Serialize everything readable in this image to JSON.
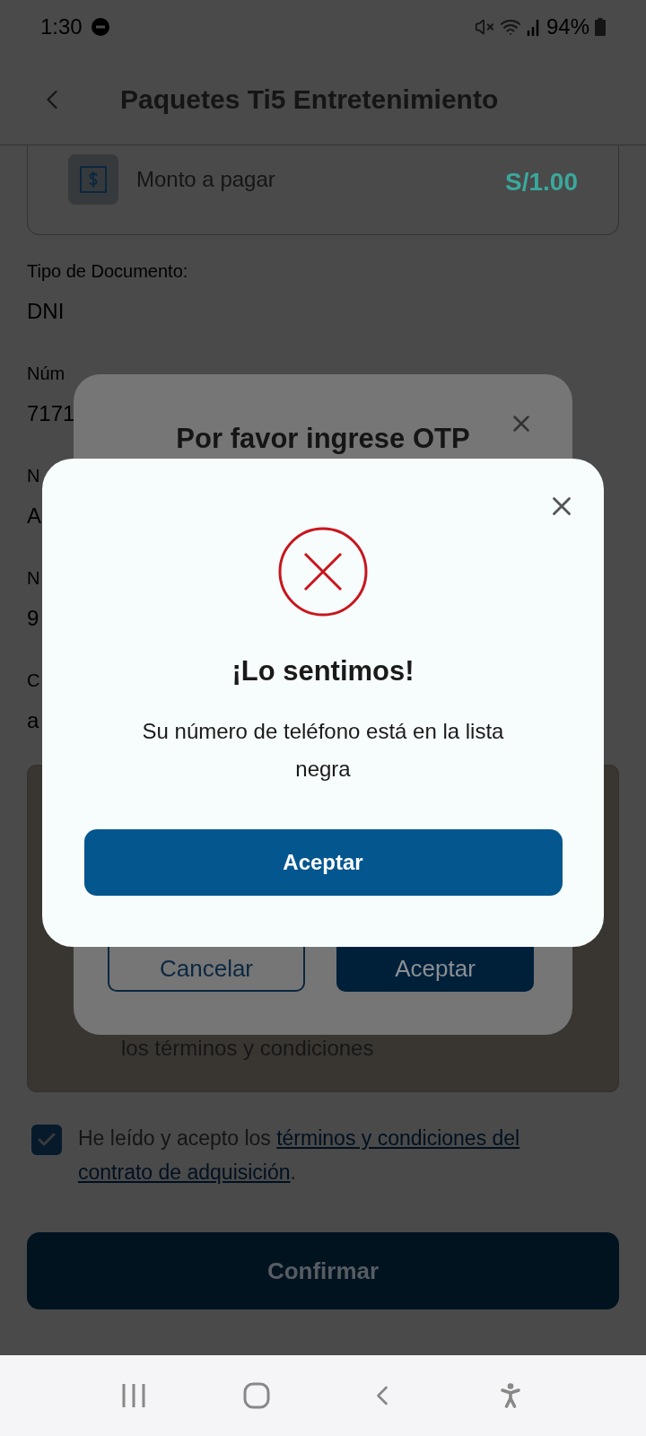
{
  "status_bar": {
    "time": "1:30",
    "battery": "94%"
  },
  "header": {
    "title": "Paquetes Ti5 Entretenimiento"
  },
  "amount": {
    "label": "Monto a pagar",
    "value": "S/1.00"
  },
  "fields": [
    {
      "label": "Tipo de Documento:",
      "value": "DNI"
    },
    {
      "label": "Núm",
      "value": "7171"
    },
    {
      "label": "N",
      "value": "A"
    },
    {
      "label": "N",
      "value": "9"
    },
    {
      "label": "C",
      "value": "a"
    }
  ],
  "terms_box": {
    "text": "los términos y condiciones"
  },
  "consent": {
    "checked": true,
    "text": "He leído y acepto los ",
    "link_lines": [
      "términos y condiciones del",
      "contrato de adquisición"
    ],
    "suffix": "."
  },
  "confirm_button": {
    "label": "Confirmar"
  },
  "otp_dialog": {
    "title": "Por favor ingrese OTP",
    "cancel": "Cancelar",
    "accept": "Aceptar"
  },
  "error_dialog": {
    "title": "¡Lo sentimos!",
    "message": "Su número de teléfono está en la lista negra",
    "button": "Aceptar"
  }
}
